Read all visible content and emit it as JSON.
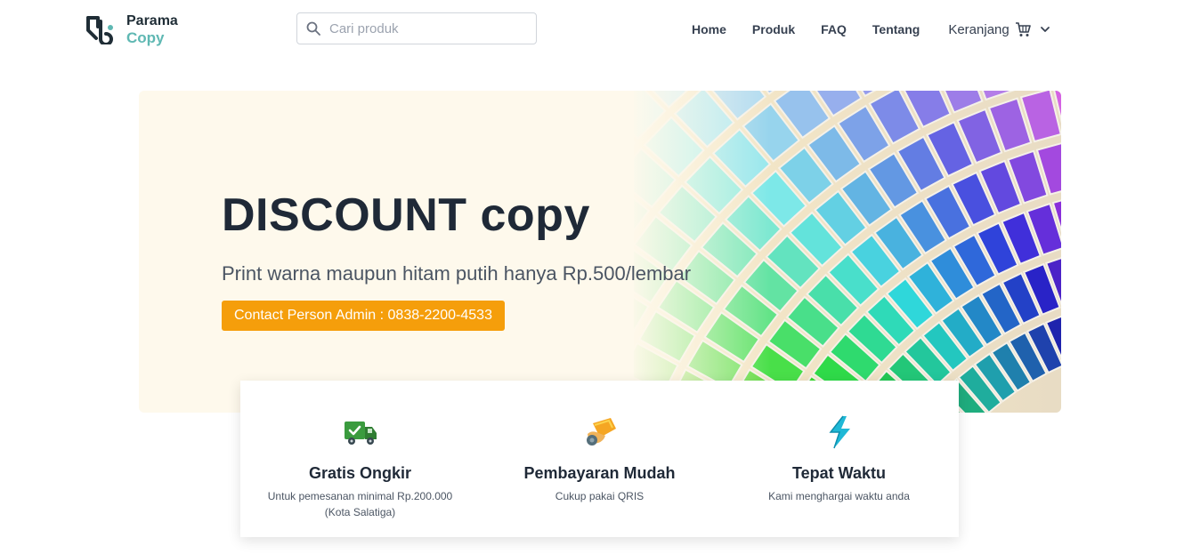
{
  "brand": {
    "line1": "Parama",
    "line2": "Copy",
    "accent_dark": "#1f2d36",
    "accent_teal": "#5fb8b3"
  },
  "search": {
    "placeholder": "Cari produk",
    "value": "",
    "icon": "search-icon"
  },
  "nav": {
    "items": [
      {
        "label": "Home"
      },
      {
        "label": "Produk"
      },
      {
        "label": "FAQ"
      },
      {
        "label": "Tentang"
      }
    ],
    "cart_label": "Keranjang",
    "cart_icon": "cart-icon",
    "dropdown_icon": "chevron-down-icon"
  },
  "hero": {
    "title": "DISCOUNT copy",
    "subtitle": "Print warna maupun hitam putih hanya Rp.500/lembar",
    "cta_label": "Contact Person Admin : 0838-2200-4533",
    "cta_color": "#f59e0b",
    "background_color": "#fef9ec",
    "image": "color-swatch-fan-image"
  },
  "features": [
    {
      "title": "Gratis Ongkir",
      "desc": "Untuk pemesanan minimal Rp.200.000 (Kota Salatiga)",
      "icon": "delivery-truck-icon"
    },
    {
      "title": "Pembayaran Mudah",
      "desc": "Cukup pakai QRIS",
      "icon": "payment-hand-icon"
    },
    {
      "title": "Tepat Waktu",
      "desc": "Kami menghargai waktu anda",
      "icon": "lightning-icon"
    }
  ]
}
